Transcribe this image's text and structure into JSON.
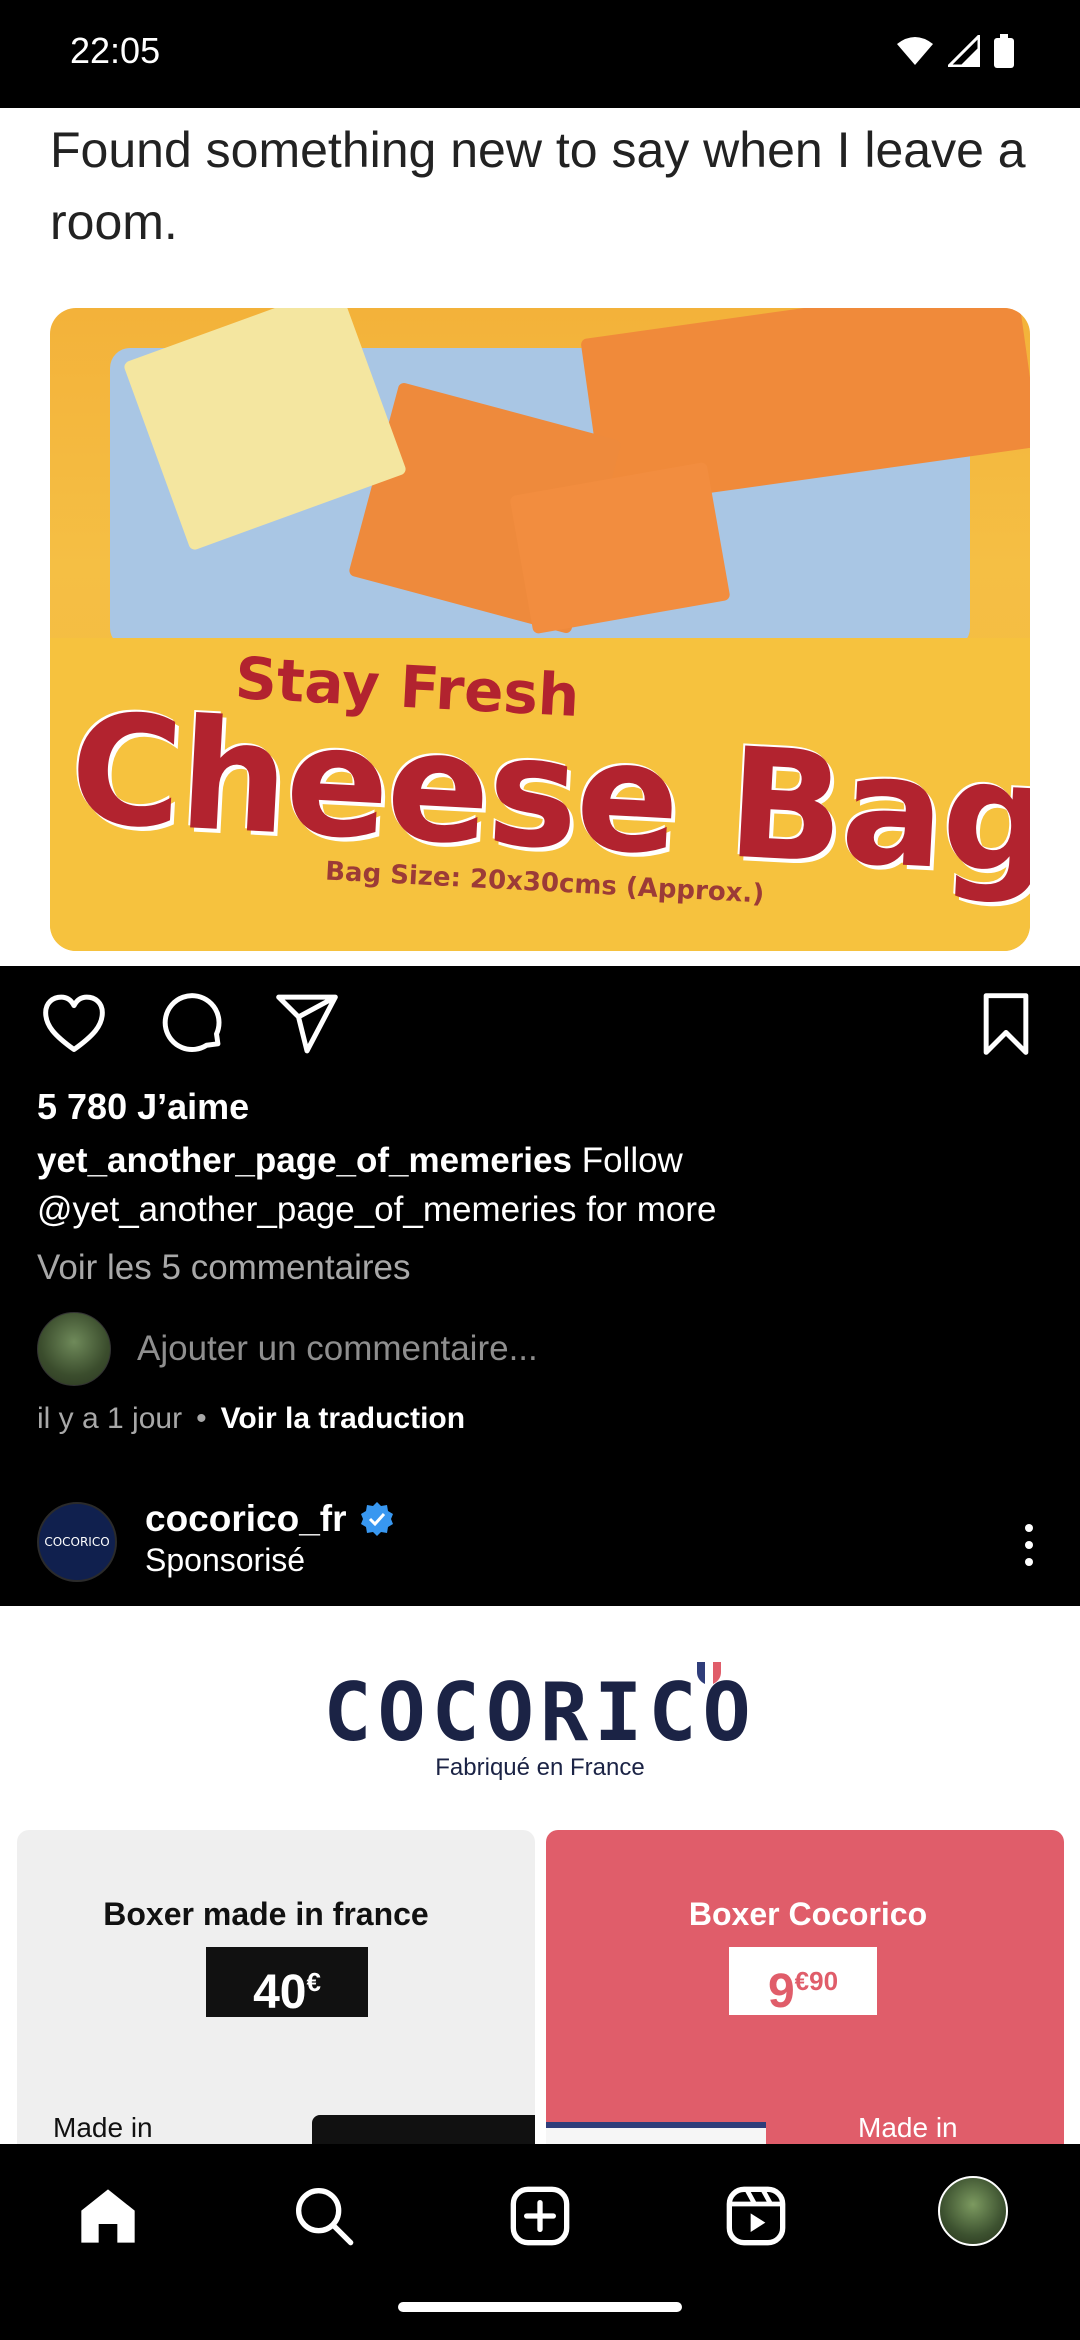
{
  "status_bar": {
    "time": "22:05",
    "icons": [
      "wifi-icon",
      "signal-icon",
      "battery-icon"
    ]
  },
  "post": {
    "meme": {
      "caption": "Found something new to say when I leave a room.",
      "package_line1": "Stay Fresh",
      "package_line2": "Cheese Bags",
      "package_size": "Bag Size: 20x30cms (Approx.)"
    },
    "likes": "5 780 J’aime",
    "author": "yet_another_page_of_memeries",
    "caption_text": " Follow @yet_another_page_of_memeries for more",
    "view_comments": "Voir les 5 commentaires",
    "add_comment_placeholder": "Ajouter un commentaire...",
    "time_ago": "il y a 1 jour",
    "separator": "•",
    "translate": "Voir la traduction"
  },
  "sponsored": {
    "avatar_text": "COCORICO",
    "name": "cocorico_fr",
    "label": "Sponsorisé"
  },
  "ad": {
    "logo": "COCORICO",
    "tagline": "Fabriqué en France",
    "cards": [
      {
        "title": "Boxer made in france",
        "price": "40",
        "currency": "€",
        "badge": "Made in"
      },
      {
        "title": "Boxer Cocorico",
        "price": "9",
        "currency": "€90",
        "badge": "Made in"
      }
    ]
  },
  "colors": {
    "accent_red": "#e05d6a",
    "navy": "#1b2345",
    "verified_blue": "#3897f0"
  }
}
